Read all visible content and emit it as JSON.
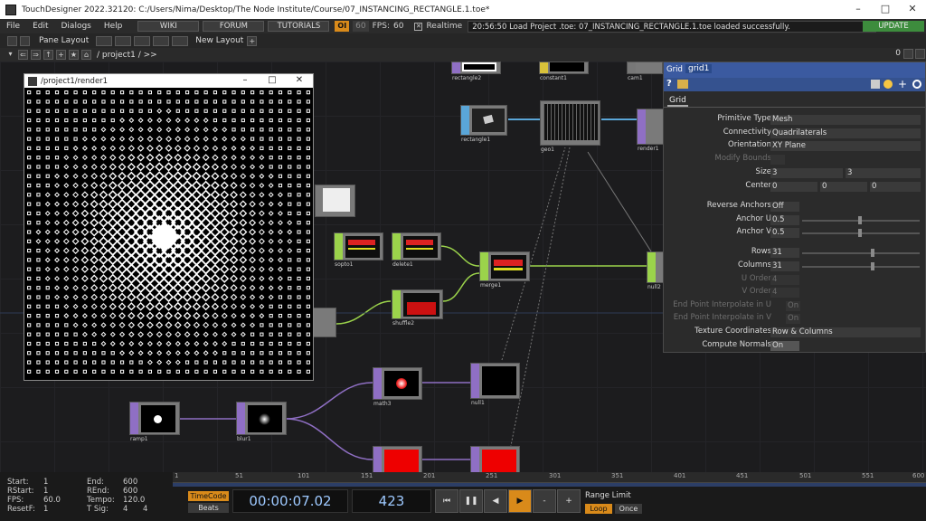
{
  "window": {
    "title": "TouchDesigner 2022.32120: C:/Users/Nima/Desktop/The Node Institute/Course/07_INSTANCING_RECTANGLE.1.toe*"
  },
  "menu": [
    "File",
    "Edit",
    "Dialogs",
    "Help"
  ],
  "toolbar": {
    "wiki": "WIKI",
    "forum": "FORUM",
    "tutorials": "TUTORIALS",
    "oi": "OI",
    "fps_cap": "60",
    "fps_label": "FPS:",
    "fps_value": "60",
    "realtime": "Realtime",
    "status_message": "20:56:50 Load Project .toe: 07_INSTANCING_RECTANGLE.1.toe loaded successfully.",
    "update": "UPDATE"
  },
  "panebar": {
    "pane_layout": "Pane Layout",
    "new_layout": "New Layout",
    "zero": "0"
  },
  "path": {
    "text": "/ project1 / >>"
  },
  "render_window": {
    "title": "/project1/render1"
  },
  "nodes": [
    {
      "id": "rectangle2",
      "label": "rectangle2"
    },
    {
      "id": "constant1",
      "label": "constant1"
    },
    {
      "id": "cam1",
      "label": "cam1"
    },
    {
      "id": "rectangle1",
      "label": "rectangle1"
    },
    {
      "id": "geo1",
      "label": "geo1"
    },
    {
      "id": "render1",
      "label": "render1"
    },
    {
      "id": "sopto1",
      "label": "sopto1"
    },
    {
      "id": "delete1",
      "label": "delete1"
    },
    {
      "id": "merge1",
      "label": "merge1"
    },
    {
      "id": "null2",
      "label": "null2"
    },
    {
      "id": "shuffle2",
      "label": "shuffle2"
    },
    {
      "id": "math3",
      "label": "math3"
    },
    {
      "id": "null1",
      "label": "null1"
    },
    {
      "id": "ramp1",
      "label": "ramp1"
    },
    {
      "id": "blur1",
      "label": "blur1"
    }
  ],
  "params": {
    "op_type": "Grid",
    "op_name": "grid1",
    "page_tab": "Grid",
    "primitive_type": {
      "label": "Primitive Type",
      "value": "Mesh"
    },
    "connectivity": {
      "label": "Connectivity",
      "value": "Quadrilaterals"
    },
    "orientation": {
      "label": "Orientation",
      "value": "XY Plane"
    },
    "modify_bounds": {
      "label": "Modify Bounds"
    },
    "size": {
      "label": "Size",
      "x": "3",
      "y": "3"
    },
    "center": {
      "label": "Center",
      "x": "0",
      "y": "0",
      "z": "0"
    },
    "reverse_anchors": {
      "label": "Reverse Anchors",
      "value": "Off"
    },
    "anchor_u": {
      "label": "Anchor U",
      "value": "0.5"
    },
    "anchor_v": {
      "label": "Anchor V",
      "value": "0.5"
    },
    "rows": {
      "label": "Rows",
      "value": "31"
    },
    "columns": {
      "label": "Columns",
      "value": "31"
    },
    "u_order": {
      "label": "U Order",
      "value": "4"
    },
    "v_order": {
      "label": "V Order",
      "value": "4"
    },
    "end_u": {
      "label": "End Point Interpolate in U",
      "value": "On"
    },
    "end_v": {
      "label": "End Point Interpolate in V",
      "value": "On"
    },
    "texture_coords": {
      "label": "Texture Coordinates",
      "value": "Row & Columns"
    },
    "compute_normals": {
      "label": "Compute Normals",
      "value": "On"
    }
  },
  "timeline": {
    "start_label": "Start:",
    "start": "1",
    "rstart_label": "RStart:",
    "rstart": "1",
    "fps_label": "FPS:",
    "fps": "60.0",
    "resetf_label": "ResetF:",
    "resetf": "1",
    "end_label": "End:",
    "end": "600",
    "rend_label": "REnd:",
    "rend": "600",
    "tempo_label": "Tempo:",
    "tempo": "120.0",
    "tsig_label": "T Sig:",
    "tsig_a": "4",
    "tsig_b": "4",
    "timecode_btn": "TimeCode",
    "beats_btn": "Beats",
    "timecode": "00:00:07.02",
    "frame": "423",
    "range_limit": "Range Limit",
    "loop": "Loop",
    "once": "Once",
    "ticks": [
      "1",
      "51",
      "101",
      "151",
      "201",
      "251",
      "301",
      "351",
      "401",
      "451",
      "501",
      "551",
      "600"
    ]
  }
}
